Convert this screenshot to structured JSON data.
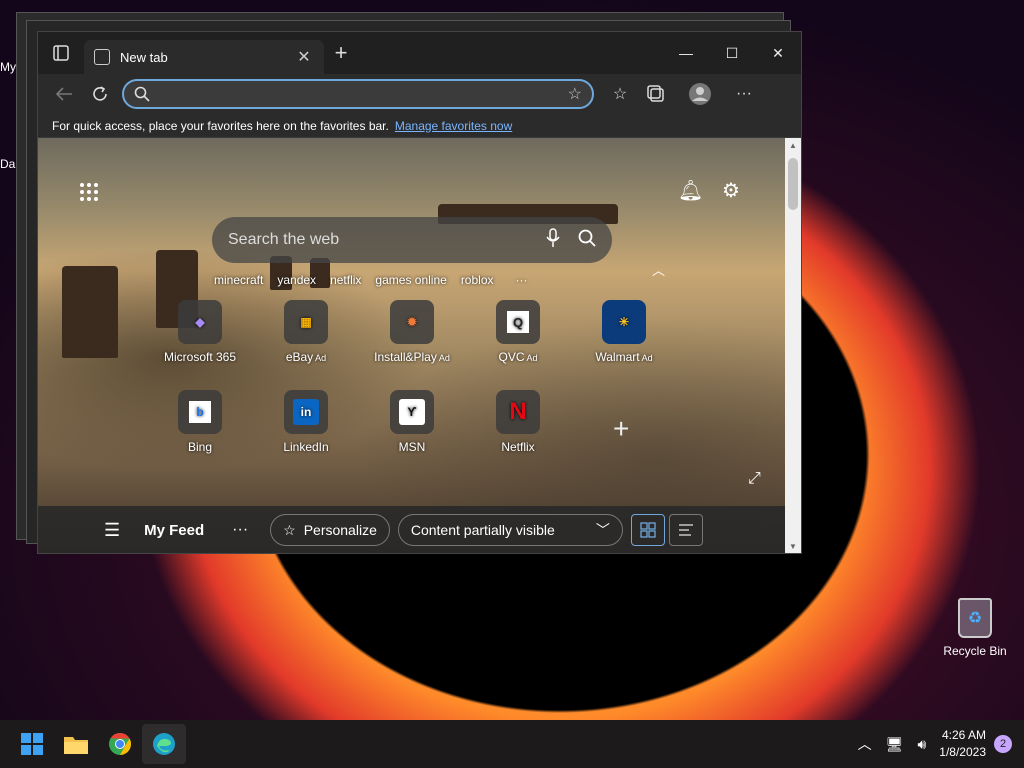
{
  "desktop": {
    "left_fragments": [
      "My",
      "Da"
    ],
    "recycle_bin_label": "Recycle Bin"
  },
  "browser": {
    "tab_title": "New tab",
    "address_placeholder": "",
    "favbar_text": "For quick access, place your favorites here on the favorites bar.",
    "favbar_link": "Manage favorites now"
  },
  "newtab": {
    "search_placeholder": "Search the web",
    "trending": [
      "minecraft",
      "yandex",
      "netflix",
      "games online",
      "roblox"
    ],
    "tiles_row1": [
      {
        "label": "Microsoft 365",
        "ad": ""
      },
      {
        "label": "eBay",
        "ad": "Ad"
      },
      {
        "label": "Install&Play",
        "ad": "Ad"
      },
      {
        "label": "QVC",
        "ad": "Ad"
      },
      {
        "label": "Walmart",
        "ad": "Ad"
      }
    ],
    "tiles_row2": [
      {
        "label": "Bing"
      },
      {
        "label": "LinkedIn"
      },
      {
        "label": "MSN"
      },
      {
        "label": "Netflix"
      }
    ]
  },
  "feedbar": {
    "title": "My Feed",
    "personalize": "Personalize",
    "content_select": "Content partially visible"
  },
  "taskbar": {
    "time": "4:26 AM",
    "date": "1/8/2023",
    "notification_count": "2"
  }
}
